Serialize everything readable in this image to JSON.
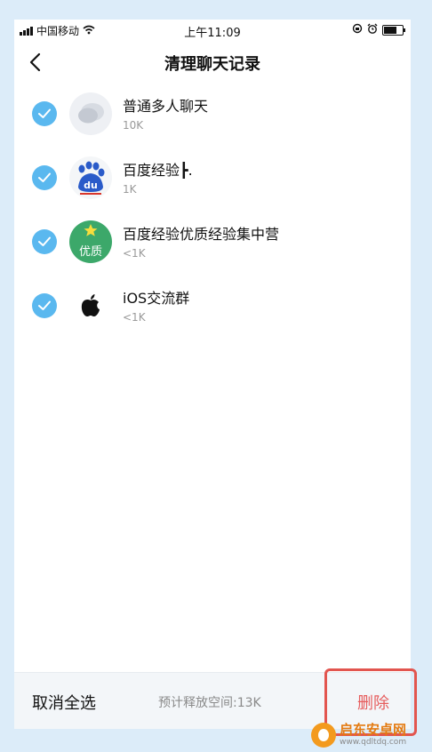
{
  "status_bar": {
    "carrier": "中国移动",
    "time": "上午11:09"
  },
  "nav": {
    "title": "清理聊天记录",
    "back_icon": "chevron-left-icon"
  },
  "chats": [
    {
      "name": "普通多人聊天",
      "size": "10K",
      "checked": true,
      "avatar": "group-chat-icon"
    },
    {
      "name": "百度经验┣.",
      "size": "1K",
      "checked": true,
      "avatar": "baidu-logo"
    },
    {
      "name": "百度经验优质经验集中营",
      "size": "<1K",
      "checked": true,
      "avatar": "youzhi-badge",
      "avatar_text": "优质"
    },
    {
      "name": "iOS交流群",
      "size": "<1K",
      "checked": true,
      "avatar": "apple-logo"
    }
  ],
  "bottom": {
    "deselect_label": "取消全选",
    "space_text": "预计释放空间:13K",
    "delete_label": "删除"
  },
  "watermark": {
    "title": "启东安卓网",
    "url": "www.qdltdq.com"
  },
  "colors": {
    "accent": "#5ab8ef",
    "delete": "#e65c5c",
    "page_bg": "#dcecf9"
  }
}
